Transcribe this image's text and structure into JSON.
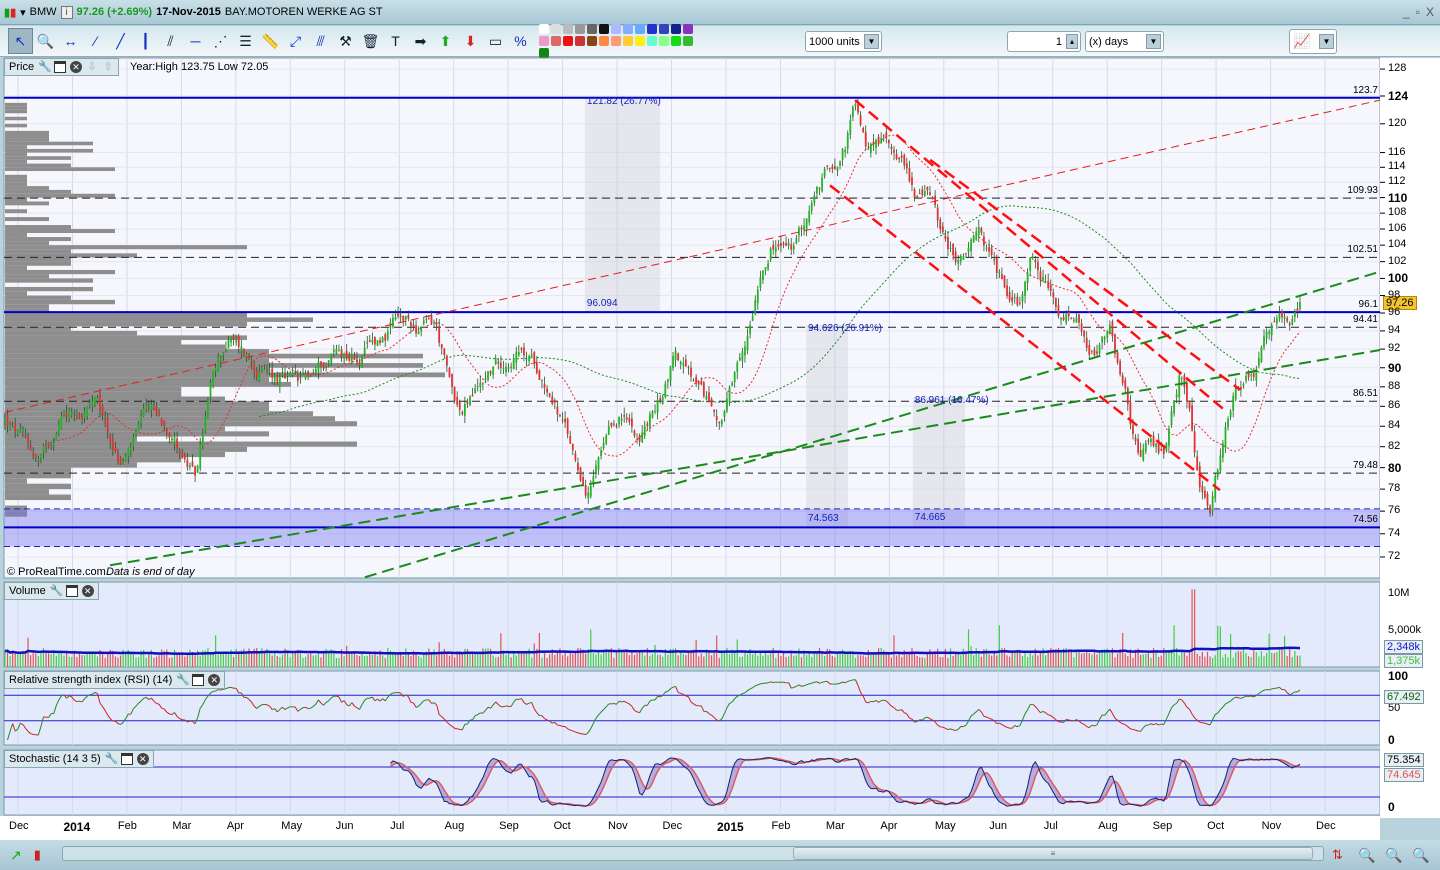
{
  "title_bar": {
    "symbol": "BMW",
    "price_change": "97.26 (+2.69%)",
    "date": "17-Nov-2015",
    "name": "BAY.MOTOREN WERKE AG ST",
    "controls": [
      "_",
      "▫",
      "X"
    ]
  },
  "toolbar": {
    "tools": [
      "pointer-icon",
      "zoom-icon",
      "horizontal-segment-icon",
      "segment-icon",
      "line-icon",
      "vertical-line-icon",
      "channel-icon",
      "horizontal-line-icon",
      "fan-icon",
      "fibonacci-icon",
      "ruler-icon",
      "point-icon",
      "parallel-icon",
      "tools-icon",
      "trash-icon",
      "text-icon",
      "arrow-right-icon",
      "arrow-up-icon",
      "arrow-down-icon",
      "rectangle-icon",
      "percent-icon"
    ],
    "colors": [
      "#ffffff",
      "#dddddd",
      "#bbbbbb",
      "#999999",
      "#666666",
      "#111111",
      "#aabbff",
      "#88aaff",
      "#66aaff",
      "#2233cc",
      "#3344bb",
      "#112288",
      "#8833bb",
      "#ee99cc",
      "#dd6666",
      "#ee1111",
      "#cc3333",
      "#884411",
      "#ff8844",
      "#ff9977",
      "#ffcc33",
      "#ffee11",
      "#66ffcc",
      "#88ff88",
      "#11dd11",
      "#33bb33",
      "#118811"
    ],
    "volume_select": "1000 units",
    "period_value": "1",
    "period_unit": "(x) days"
  },
  "price_panel": {
    "label": "Price",
    "year_info": "Year:High 123.75 Low 72.05",
    "copyright": "© ProRealTime.com",
    "note": "Data is end of day",
    "last_price": "97.26"
  },
  "volume_panel": {
    "label": "Volume",
    "ticks": [
      {
        "v": 10,
        "t": "10M"
      },
      {
        "v": 5,
        "t": "5,000k"
      }
    ],
    "avg_badge": "2,348k",
    "last_badge": "1,375k"
  },
  "rsi_panel": {
    "label": "Relative strength index (RSI) (14)",
    "ticks": [
      {
        "v": 100,
        "t": "100"
      },
      {
        "v": 50,
        "t": "50"
      },
      {
        "v": 0,
        "t": "0"
      }
    ],
    "badge": "67.492"
  },
  "stoch_panel": {
    "label": "Stochastic (14 3 5)",
    "ticks": [
      {
        "v": 0,
        "t": "0"
      }
    ],
    "badge_k": "75.354",
    "badge_d": "74.645"
  },
  "chart_data": {
    "type": "candlestick",
    "scale": "log",
    "ylim": [
      70,
      130
    ],
    "price_ticks": [
      {
        "v": 128,
        "b": 0
      },
      {
        "v": 124,
        "b": 1
      },
      {
        "v": 120,
        "b": 0
      },
      {
        "v": 116,
        "b": 0
      },
      {
        "v": 114,
        "b": 0
      },
      {
        "v": 112,
        "b": 0
      },
      {
        "v": 110,
        "b": 1
      },
      {
        "v": 108,
        "b": 0
      },
      {
        "v": 106,
        "b": 0
      },
      {
        "v": 104,
        "b": 0
      },
      {
        "v": 102,
        "b": 0
      },
      {
        "v": 100,
        "b": 1
      },
      {
        "v": 98,
        "b": 0
      },
      {
        "v": 96,
        "b": 0
      },
      {
        "v": 94,
        "b": 0
      },
      {
        "v": 92,
        "b": 0
      },
      {
        "v": 90,
        "b": 1
      },
      {
        "v": 88,
        "b": 0
      },
      {
        "v": 86,
        "b": 0
      },
      {
        "v": 84,
        "b": 0
      },
      {
        "v": 82,
        "b": 0
      },
      {
        "v": 80,
        "b": 1
      },
      {
        "v": 78,
        "b": 0
      },
      {
        "v": 76,
        "b": 0
      },
      {
        "v": 74,
        "b": 0
      },
      {
        "v": 72,
        "b": 0
      }
    ],
    "x_labels": [
      {
        "m": 0,
        "t": "Dec"
      },
      {
        "m": 1,
        "t": "2014",
        "b": 1
      },
      {
        "m": 2,
        "t": "Feb"
      },
      {
        "m": 3,
        "t": "Mar"
      },
      {
        "m": 4,
        "t": "Apr"
      },
      {
        "m": 5,
        "t": "May"
      },
      {
        "m": 6,
        "t": "Jun"
      },
      {
        "m": 7,
        "t": "Jul"
      },
      {
        "m": 8,
        "t": "Aug"
      },
      {
        "m": 9,
        "t": "Sep"
      },
      {
        "m": 10,
        "t": "Oct"
      },
      {
        "m": 11,
        "t": "Nov"
      },
      {
        "m": 12,
        "t": "Dec"
      },
      {
        "m": 13,
        "t": "2015",
        "b": 1
      },
      {
        "m": 14,
        "t": "Feb"
      },
      {
        "m": 15,
        "t": "Mar"
      },
      {
        "m": 16,
        "t": "Apr"
      },
      {
        "m": 17,
        "t": "May"
      },
      {
        "m": 18,
        "t": "Jun"
      },
      {
        "m": 19,
        "t": "Jul"
      },
      {
        "m": 20,
        "t": "Aug"
      },
      {
        "m": 21,
        "t": "Sep"
      },
      {
        "m": 22,
        "t": "Oct"
      },
      {
        "m": 23,
        "t": "Nov"
      },
      {
        "m": 24,
        "t": "Dec"
      }
    ],
    "price_path_months_since_dec2013": [
      [
        -0.24,
        84.6
      ],
      [
        0.4,
        80.2
      ],
      [
        0.84,
        85.6
      ],
      [
        1.41,
        86.2
      ],
      [
        1.89,
        80.2
      ],
      [
        2.42,
        85.1
      ],
      [
        2.85,
        83.6
      ],
      [
        3.25,
        78.9
      ],
      [
        3.53,
        87.7
      ],
      [
        3.86,
        93.0
      ],
      [
        4.44,
        89.8
      ],
      [
        4.79,
        88.7
      ],
      [
        5.18,
        87.7
      ],
      [
        5.82,
        91.9
      ],
      [
        6.28,
        91.4
      ],
      [
        6.92,
        94.7
      ],
      [
        7.38,
        94.1
      ],
      [
        7.66,
        94.7
      ],
      [
        7.93,
        87.7
      ],
      [
        8.15,
        85.1
      ],
      [
        8.67,
        89.8
      ],
      [
        9.13,
        91.9
      ],
      [
        9.59,
        89.8
      ],
      [
        9.86,
        86.7
      ],
      [
        10.23,
        80.7
      ],
      [
        10.47,
        77.9
      ],
      [
        10.69,
        80.7
      ],
      [
        11.05,
        84.6
      ],
      [
        11.42,
        83.1
      ],
      [
        11.79,
        86.7
      ],
      [
        12.06,
        91.9
      ],
      [
        12.52,
        86.7
      ],
      [
        12.89,
        84.6
      ],
      [
        13.35,
        90.8
      ],
      [
        13.62,
        101.0
      ],
      [
        13.81,
        104.6
      ],
      [
        14.27,
        103.4
      ],
      [
        14.54,
        108.4
      ],
      [
        14.91,
        113.6
      ],
      [
        15.19,
        117.7
      ],
      [
        15.37,
        122.7
      ],
      [
        15.55,
        116.4
      ],
      [
        15.83,
        117.7
      ],
      [
        16.2,
        116.4
      ],
      [
        16.47,
        111.0
      ],
      [
        16.84,
        109.7
      ],
      [
        17.02,
        104.6
      ],
      [
        17.3,
        102.2
      ],
      [
        17.66,
        104.6
      ],
      [
        18.03,
        99.8
      ],
      [
        18.4,
        97.5
      ],
      [
        18.58,
        103.4
      ],
      [
        18.86,
        99.8
      ],
      [
        19.13,
        94.1
      ],
      [
        19.41,
        95.2
      ],
      [
        19.68,
        89.8
      ],
      [
        20.05,
        93.0
      ],
      [
        20.33,
        86.7
      ],
      [
        20.6,
        79.8
      ],
      [
        20.79,
        82.6
      ],
      [
        21.06,
        80.7
      ],
      [
        21.34,
        88.7
      ],
      [
        21.52,
        85.1
      ],
      [
        21.7,
        77.9
      ],
      [
        21.89,
        75.7
      ],
      [
        22.07,
        80.7
      ],
      [
        22.35,
        88.7
      ],
      [
        22.71,
        89.8
      ],
      [
        22.81,
        93.0
      ],
      [
        23.17,
        95.2
      ],
      [
        23.36,
        94.1
      ],
      [
        23.54,
        97.26
      ]
    ],
    "levels": [
      {
        "p": 123.75,
        "t": "123.7",
        "solid": 1
      },
      {
        "p": 109.93,
        "t": "109.93"
      },
      {
        "p": 102.51,
        "t": "102.51"
      },
      {
        "p": 96.1,
        "t": "96.1",
        "solid": 1
      },
      {
        "p": 94.41,
        "t": "94.41"
      },
      {
        "p": 86.51,
        "t": "86.51"
      },
      {
        "p": 79.48,
        "t": "79.48"
      },
      {
        "p": 74.56,
        "t": "74.56",
        "solid": 1
      }
    ],
    "support_zone": [
      72.9,
      76.2
    ],
    "trendlines": [
      {
        "c": "#e02020",
        "w": 1,
        "a": [
          -0.24,
          85.4
        ],
        "b": [
          25.01,
          123.4
        ]
      },
      {
        "c": "#1a8a1a",
        "w": 2,
        "a": [
          6.37,
          70.3
        ],
        "b": [
          25.01,
          100.8
        ]
      },
      {
        "c": "#1a8a1a",
        "w": 2,
        "a": [
          1.69,
          71.3
        ],
        "b": [
          25.01,
          91.9
        ]
      },
      {
        "c": "#ff1010",
        "w": 2.5,
        "a": [
          15.37,
          123.4
        ],
        "b": [
          22.16,
          85.6
        ]
      },
      {
        "c": "#ff1010",
        "w": 2.5,
        "a": [
          14.91,
          111.6
        ],
        "b": [
          22.07,
          77.9
        ]
      },
      {
        "c": "#ff1010",
        "w": 2.5,
        "a": [
          16.75,
          115.0
        ],
        "b": [
          22.44,
          87.7
        ]
      }
    ],
    "retracements": [
      {
        "m0": 10.41,
        "m1": 11.79,
        "top": 123.75,
        "bot": 96.1,
        "top_label": "121.82 (26.77%)",
        "bot_label": "96.094"
      },
      {
        "m0": 14.47,
        "m1": 15.24,
        "top": 94.63,
        "bot": 74.56,
        "top_label": "94.626 (26.91%)",
        "bot_label": "74.563"
      },
      {
        "m0": 16.43,
        "m1": 17.39,
        "top": 86.96,
        "bot": 74.67,
        "top_label": "86.961 (16.47%)",
        "bot_label": "74.665"
      }
    ],
    "colors": {
      "up": "#22b422",
      "down": "#e03232",
      "level": "#0000c8",
      "band": "#6e6ef0"
    }
  }
}
